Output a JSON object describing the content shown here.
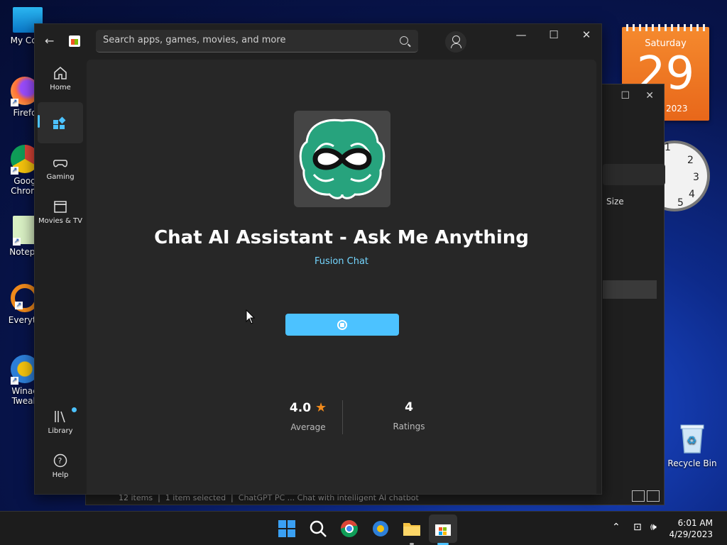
{
  "desktop": {
    "icons": [
      {
        "label": "My Com"
      },
      {
        "label": "Firefo"
      },
      {
        "label": "Goog Chrom"
      },
      {
        "label": "Notepa"
      },
      {
        "label": "Everyth"
      },
      {
        "label": "Winae Tweak"
      }
    ],
    "recycle_bin": "Recycle Bin"
  },
  "calendar": {
    "day_name": "Saturday",
    "day_number": "29",
    "year": "2023"
  },
  "background_window": {
    "column_size": "Size",
    "status": {
      "items": "12 items",
      "selected": "1 item selected",
      "extra": "ChatGPT PC ... Chat with intelligent AI chatbot"
    }
  },
  "store": {
    "search_placeholder": "Search apps, games, movies, and more",
    "nav": {
      "home": "Home",
      "gaming": "Gaming",
      "movies": "Movies & TV",
      "library": "Library",
      "help": "Help"
    },
    "app": {
      "title": "Chat AI Assistant - Ask Me Anything",
      "publisher": "Fusion Chat",
      "rating_value": "4.0",
      "rating_label": "Average",
      "ratings_count": "4",
      "ratings_label": "Ratings"
    }
  },
  "taskbar": {
    "time": "6:01 AM",
    "date": "4/29/2023"
  },
  "colors": {
    "accent": "#4cc2ff",
    "publisher": "#74d6ff",
    "star": "#f08a1c",
    "calendar": "#ee7422"
  }
}
